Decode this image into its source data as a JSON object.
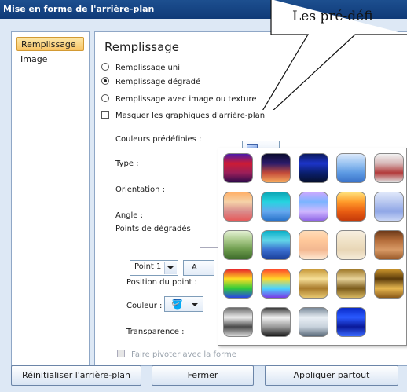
{
  "window": {
    "title": "Mise en forme de l'arrière-plan"
  },
  "callout": {
    "text": "Les pré-défi"
  },
  "nav": {
    "items": [
      {
        "label": "Remplissage",
        "active": true
      },
      {
        "label": "Image",
        "active": false
      }
    ]
  },
  "panel": {
    "title": "Remplissage",
    "options": [
      {
        "label": "Remplissage uni",
        "type": "radio",
        "selected": false
      },
      {
        "label": "Remplissage dégradé",
        "type": "radio",
        "selected": true
      },
      {
        "label": "Remplissage avec image ou texture",
        "type": "radio",
        "selected": false
      },
      {
        "label": "Masquer les graphiques d'arrière-plan",
        "type": "checkbox",
        "checked": false
      }
    ],
    "fields": {
      "preset_colors": "Couleurs prédéfinies :",
      "type": "Type :",
      "orientation": "Orientation :",
      "angle": "Angle :",
      "gradient_points": "Points de dégradés",
      "point_position": "Position du point :",
      "color": "Couleur :",
      "transparency": "Transparence :"
    },
    "point_select": {
      "value": "Point 1"
    },
    "add_button": {
      "label": "A"
    },
    "rotate_with_shape": {
      "label": "Faire pivoter avec la forme",
      "enabled": false
    }
  },
  "footer": {
    "reset": "Réinitialiser l'arrière-plan",
    "close": "Fermer",
    "apply_all": "Appliquer partout"
  },
  "preset_gradients": [
    [
      "#4c1aa8",
      "#cc1b35",
      "#9a1f5a",
      "#2f0a4a"
    ],
    [
      "#0b0b2e",
      "#2b1b6a",
      "#c34b3a",
      "#f6a95d"
    ],
    [
      "#0b1a5e",
      "#1c34c8",
      "#0a1f6e",
      "#06102e"
    ],
    [
      "#dbe8fb",
      "#9cc5f2",
      "#5d9ae3",
      "#3b73c9"
    ],
    [
      "#f2f2f2",
      "#d7b8b8",
      "#b23a3a",
      "#e0e0e0"
    ],
    [
      "#ffb068",
      "#f5d2a8",
      "#d98c8c",
      "#e65a5a"
    ],
    [
      "#0ca6b6",
      "#26d4e0",
      "#66a8ef",
      "#2a73c9"
    ],
    [
      "#c9a8ff",
      "#7ab4ff",
      "#d0b8ff",
      "#8f66e6"
    ],
    [
      "#ffe07a",
      "#ff9b2a",
      "#e95d12",
      "#c43a0a"
    ],
    [
      "#dfe7fa",
      "#b9c8f0",
      "#8fa6e6",
      "#c9d6f6"
    ],
    [
      "#e3f0d3",
      "#a9c98a",
      "#6b9a4b",
      "#3d6a2a"
    ],
    [
      "#0ab0c8",
      "#62d6e8",
      "#3a6fd0",
      "#1a3f9a"
    ],
    [
      "#ffdcb8",
      "#ffc89a",
      "#f3b891",
      "#ffe9d3"
    ],
    [
      "#f7efe0",
      "#f0e3c8",
      "#e8d6b6",
      "#f6ecd9"
    ],
    [
      "#6d3a1a",
      "#b56d3a",
      "#d89a66",
      "#9a5a2a"
    ],
    [
      "#e8282a",
      "#ffdd22",
      "#2fcc3a",
      "#2a42e6"
    ],
    [
      "#ff4a2a",
      "#ffd82a",
      "#4ad6ff",
      "#7a3ae6"
    ],
    [
      "#c89a3a",
      "#f6df98",
      "#a87a2a",
      "#e8c870"
    ],
    [
      "#a07a2a",
      "#e8d39a",
      "#7a5a1a",
      "#d8b860"
    ],
    [
      "#c8922a",
      "#5a3a0a",
      "#e8b850",
      "#8a5a1a"
    ],
    [
      "#6a6a6a",
      "#ececec",
      "#4a4a4a",
      "#d8d8d8"
    ],
    [
      "#3a3a3a",
      "#f2f2f2",
      "#9a9a9a",
      "#1a1a1a"
    ],
    [
      "#7a8a9a",
      "#e8eef4",
      "#c8d2dc",
      "#5a6a7a"
    ],
    [
      "#0a2ac8",
      "#2a5aff",
      "#0a1a9a",
      "#3a6aff"
    ]
  ]
}
